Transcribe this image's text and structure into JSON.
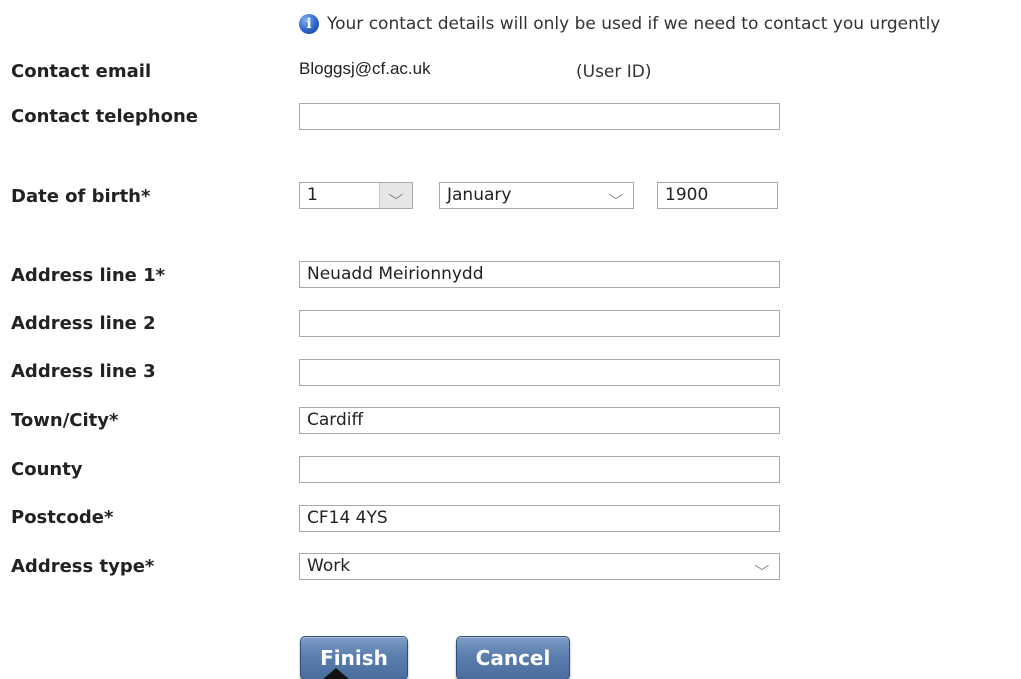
{
  "info": {
    "icon": "info-icon",
    "message": "Your contact details will only be used if we need to contact you urgently"
  },
  "contact_email": {
    "label": "Contact email",
    "value": "Bloggsj@cf.ac.uk",
    "note": "(User ID)"
  },
  "contact_telephone": {
    "label": "Contact telephone",
    "value": ""
  },
  "date_of_birth": {
    "label": "Date of birth*",
    "day": "1",
    "month": "January",
    "year": "1900"
  },
  "address_line_1": {
    "label": "Address line 1*",
    "value": "Neuadd Meirionnydd"
  },
  "address_line_2": {
    "label": "Address line 2",
    "value": ""
  },
  "address_line_3": {
    "label": "Address line 3",
    "value": ""
  },
  "town_city": {
    "label": "Town/City*",
    "value": "Cardiff"
  },
  "county": {
    "label": "County",
    "value": ""
  },
  "postcode": {
    "label": "Postcode*",
    "value": "CF14 4YS"
  },
  "address_type": {
    "label": "Address type*",
    "value": "Work"
  },
  "buttons": {
    "finish": "Finish",
    "cancel": "Cancel"
  },
  "colors": {
    "button_blue": "#5a7eae",
    "info_icon_blue": "#2b63c9"
  }
}
